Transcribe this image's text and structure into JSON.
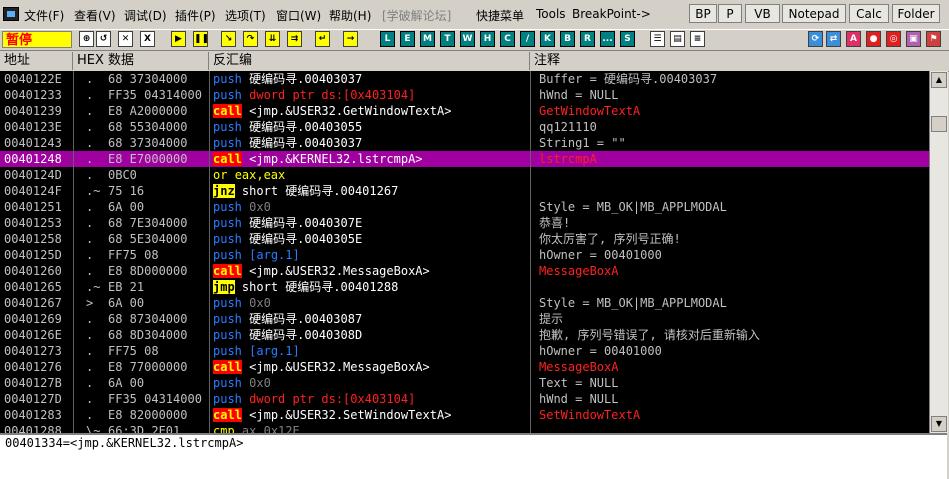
{
  "menu": [
    "文件(F)",
    "查看(V)",
    "调试(D)",
    "插件(P)",
    "选项(T)",
    "窗口(W)",
    "帮助(H)",
    "[学破解论坛]",
    "快捷菜单",
    "Tools",
    "BreakPoint->"
  ],
  "right_buttons": [
    "BP",
    "P",
    "VB",
    "Notepad",
    "Calc",
    "Folder"
  ],
  "toolbar": {
    "status": "暂停",
    "letters": [
      "L",
      "E",
      "M",
      "T",
      "W",
      "H",
      "C",
      "/",
      "K",
      "B",
      "R",
      "...",
      "S"
    ]
  },
  "columns": {
    "addr": "地址",
    "hex": "HEX 数据",
    "disasm": "反汇编",
    "comment": "注释"
  },
  "rows": [
    {
      "addr": "0040122E",
      "mark": ".",
      "hex": "68 37304000",
      "mnem": "push",
      "args": "硬编码寻.00403037",
      "comment": "Buffer = 硬编码寻.00403037"
    },
    {
      "addr": "00401233",
      "mark": ".",
      "hex": "FF35 04314000",
      "mnem": "push",
      "args": "dword ptr ds:[0x403104]",
      "comment": "hWnd = NULL"
    },
    {
      "addr": "00401239",
      "mark": ".",
      "hex": "E8 A2000000",
      "mnem": "call",
      "args": "<jmp.&USER32.GetWindowTextA>",
      "comment": "GetWindowTextA"
    },
    {
      "addr": "0040123E",
      "mark": ".",
      "hex": "68 55304000",
      "mnem": "push",
      "args": "硬编码寻.00403055",
      "comment": "qq121110"
    },
    {
      "addr": "00401243",
      "mark": ".",
      "hex": "68 37304000",
      "mnem": "push",
      "args": "硬编码寻.00403037",
      "comment": "String1 = \"\""
    },
    {
      "addr": "00401248",
      "mark": ".",
      "hex": "E8 E7000000",
      "mnem": "call",
      "args": "<jmp.&KERNEL32.lstrcmpA>",
      "comment": "lstrcmpA",
      "selected": true
    },
    {
      "addr": "0040124D",
      "mark": ".",
      "hex": "0BC0",
      "mnem": "or",
      "args": "eax,eax",
      "comment": ""
    },
    {
      "addr": "0040124F",
      "mark": ".~",
      "hex": "75 16",
      "mnem": "jnz",
      "args": "short 硬编码寻.00401267",
      "comment": ""
    },
    {
      "addr": "00401251",
      "mark": ".",
      "hex": "6A 00",
      "mnem": "push",
      "args": "0x0",
      "comment": "Style = MB_OK|MB_APPLMODAL"
    },
    {
      "addr": "00401253",
      "mark": ".",
      "hex": "68 7E304000",
      "mnem": "push",
      "args": "硬编码寻.0040307E",
      "comment": "恭喜!"
    },
    {
      "addr": "00401258",
      "mark": ".",
      "hex": "68 5E304000",
      "mnem": "push",
      "args": "硬编码寻.0040305E",
      "comment": "你太厉害了, 序列号正确!"
    },
    {
      "addr": "0040125D",
      "mark": ".",
      "hex": "FF75 08",
      "mnem": "push",
      "args": "[arg.1]",
      "comment": "hOwner = 00401000"
    },
    {
      "addr": "00401260",
      "mark": ".",
      "hex": "E8 8D000000",
      "mnem": "call",
      "args": "<jmp.&USER32.MessageBoxA>",
      "comment": "MessageBoxA"
    },
    {
      "addr": "00401265",
      "mark": ".~",
      "hex": "EB 21",
      "mnem": "jmp",
      "args": "short 硬编码寻.00401288",
      "comment": ""
    },
    {
      "addr": "00401267",
      "mark": ">",
      "hex": "6A 00",
      "mnem": "push",
      "args": "0x0",
      "comment": "Style = MB_OK|MB_APPLMODAL"
    },
    {
      "addr": "00401269",
      "mark": ".",
      "hex": "68 87304000",
      "mnem": "push",
      "args": "硬编码寻.00403087",
      "comment": "提示"
    },
    {
      "addr": "0040126E",
      "mark": ".",
      "hex": "68 8D304000",
      "mnem": "push",
      "args": "硬编码寻.0040308D",
      "comment": "抱歉, 序列号错误了, 请核对后重新输入"
    },
    {
      "addr": "00401273",
      "mark": ".",
      "hex": "FF75 08",
      "mnem": "push",
      "args": "[arg.1]",
      "comment": "hOwner = 00401000"
    },
    {
      "addr": "00401276",
      "mark": ".",
      "hex": "E8 77000000",
      "mnem": "call",
      "args": "<jmp.&USER32.MessageBoxA>",
      "comment": "MessageBoxA"
    },
    {
      "addr": "0040127B",
      "mark": ".",
      "hex": "6A 00",
      "mnem": "push",
      "args": "0x0",
      "comment": "Text = NULL"
    },
    {
      "addr": "0040127D",
      "mark": ".",
      "hex": "FF35 04314000",
      "mnem": "push",
      "args": "dword ptr ds:[0x403104]",
      "comment": "hWnd = NULL"
    },
    {
      "addr": "00401283",
      "mark": ".",
      "hex": "E8 82000000",
      "mnem": "call",
      "args": "<jmp.&USER32.SetWindowTextA>",
      "comment": "SetWindowTextA"
    },
    {
      "addr": "00401288",
      "mark": "\\~",
      "hex": "66:3D 2E01",
      "mnem": "cmp",
      "args": "ax,0x12E",
      "comment": ""
    }
  ],
  "status_line": "00401334=<jmp.&KERNEL32.lstrcmpA>",
  "colors": {
    "selected_row": "#a000a0",
    "call_bg": "#ff0000",
    "jmp_bg": "#ffff00",
    "push_fg": "#2b7bff"
  }
}
